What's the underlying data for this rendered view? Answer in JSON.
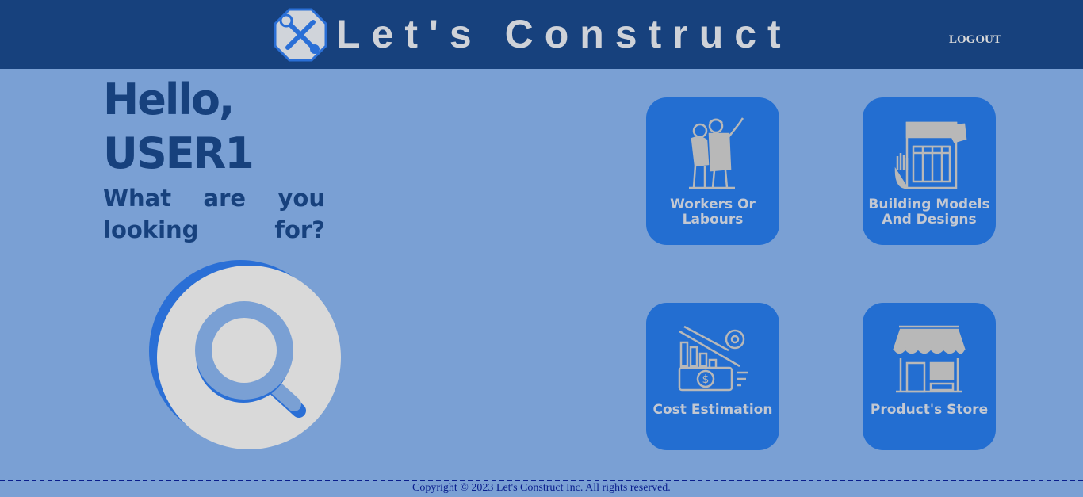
{
  "header": {
    "brand": "Let's Construct",
    "logout_label": "LOGOUT",
    "logo_icon": "wrench-screwdriver-icon"
  },
  "greeting": {
    "hello": "Hello,",
    "user": "USER1",
    "question": "What are you looking for?"
  },
  "cards": [
    {
      "label": "Workers Or Labours",
      "icon": "workers-icon"
    },
    {
      "label": "Building Models And Designs",
      "icon": "blueprint-icon"
    },
    {
      "label": "Cost Estimation",
      "icon": "cost-estimation-icon"
    },
    {
      "label": "Product's Store",
      "icon": "store-icon"
    }
  ],
  "footer": {
    "copyright": "Copyright © 2023 Let's Construct Inc. All rights reserved."
  },
  "colors": {
    "header_bg": "#17417d",
    "page_bg": "#7aa0d4",
    "card_bg": "#236ed1",
    "text_dark": "#17417d",
    "footer_text": "#0a1e8c"
  }
}
